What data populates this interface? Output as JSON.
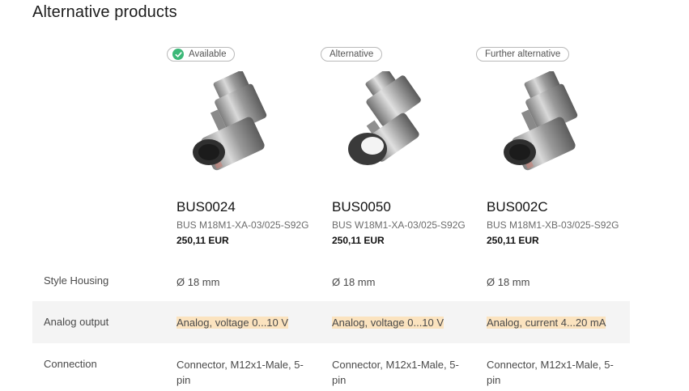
{
  "section": {
    "title": "Alternative products"
  },
  "products": [
    {
      "badge": "Available",
      "badge_icon": "check-icon",
      "sku": "BUS0024",
      "model": "BUS M18M1-XA-03/025-S92G",
      "price": "250,11 EUR"
    },
    {
      "badge": "Alternative",
      "sku": "BUS0050",
      "model": "BUS W18M1-XA-03/025-S92G",
      "price": "250,11 EUR"
    },
    {
      "badge": "Further alternative",
      "sku": "BUS002C",
      "model": "BUS M18M1-XB-03/025-S92G",
      "price": "250,11 EUR"
    }
  ],
  "specs": [
    {
      "label": "Style Housing",
      "values": [
        "Ø 18 mm",
        "Ø 18 mm",
        "Ø 18 mm"
      ]
    },
    {
      "label": "Analog output",
      "values": [
        "Analog, voltage 0...10 V",
        "Analog, voltage 0...10 V",
        "Analog, current 4...20 mA"
      ]
    },
    {
      "label": "Connection",
      "values": [
        "Connector, M12x1-Male, 5-pin",
        "Connector, M12x1-Male, 5-pin",
        "Connector, M12x1-Male, 5-pin"
      ]
    }
  ],
  "colors": {
    "available_green": "#3cb878",
    "highlight": "#fbe3bf",
    "row_shade": "#f4f4f4"
  }
}
